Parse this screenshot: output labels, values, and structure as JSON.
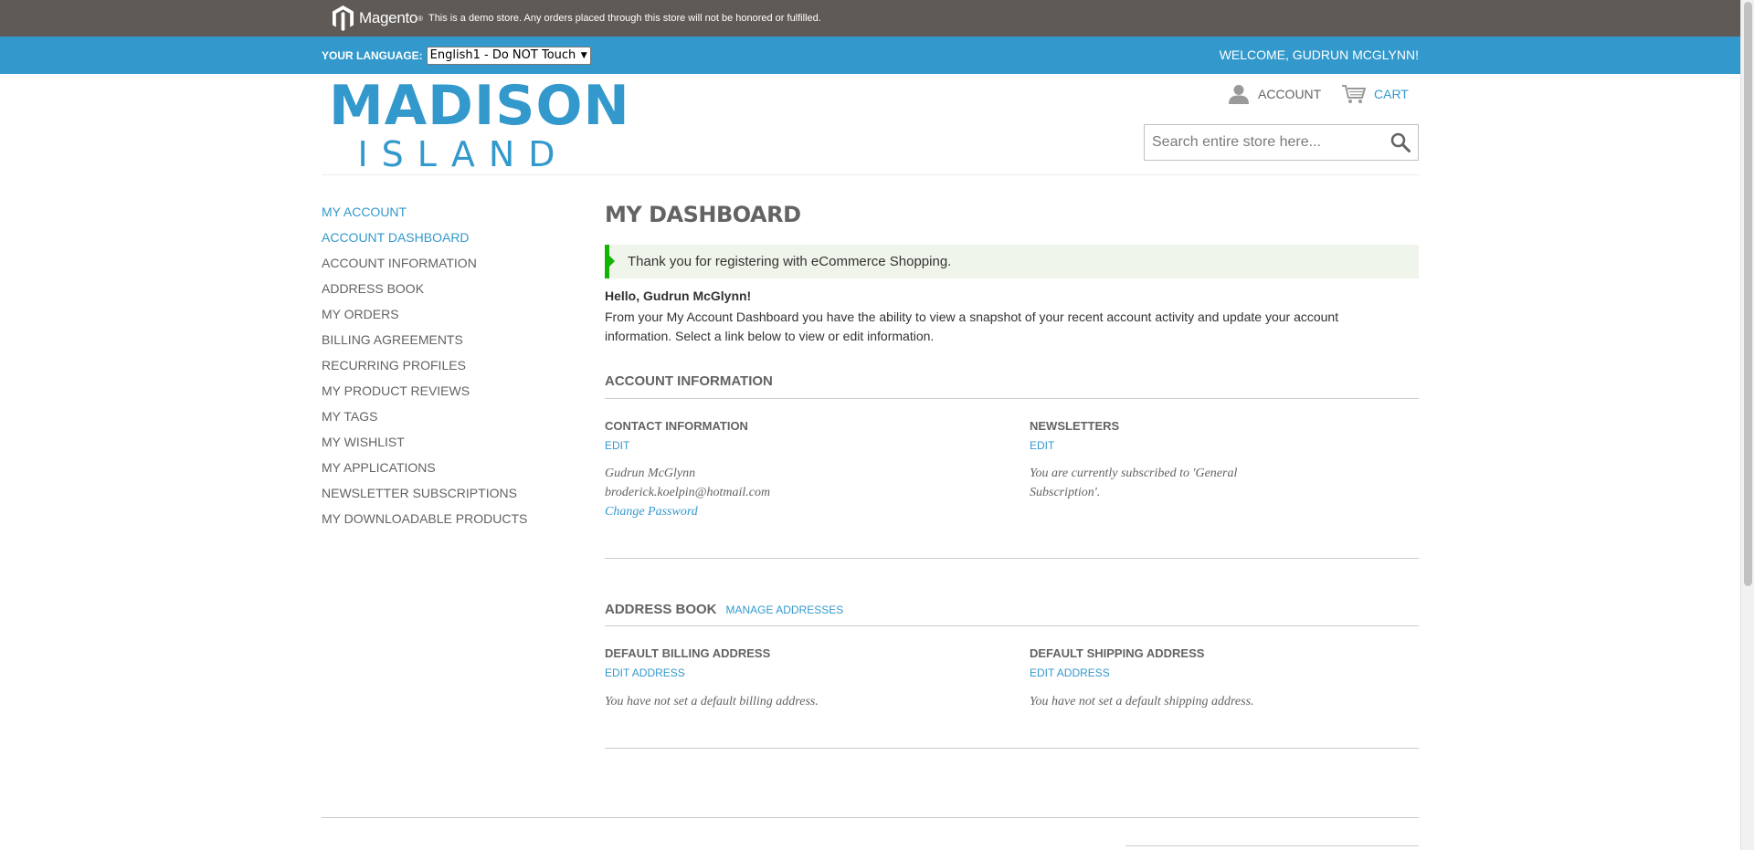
{
  "demo_notice": {
    "brand": "Magento",
    "text": "This is a demo store. Any orders placed through this store will not be honored or fulfilled."
  },
  "language_bar": {
    "label": "Your Language:",
    "selected": "English1 - Do NOT Touch",
    "welcome": "WELCOME, GUDRUN MCGLYNN!"
  },
  "logo": {
    "line1": "MADISON",
    "line2": "ISLAND"
  },
  "header": {
    "account": "Account",
    "cart": "Cart",
    "search_placeholder": "Search entire store here..."
  },
  "sidebar": {
    "title": "My Account",
    "items": [
      {
        "label": "Account Dashboard",
        "current": true
      },
      {
        "label": "Account Information"
      },
      {
        "label": "Address Book"
      },
      {
        "label": "My Orders"
      },
      {
        "label": "Billing Agreements"
      },
      {
        "label": "Recurring Profiles"
      },
      {
        "label": "My Product Reviews"
      },
      {
        "label": "My Tags"
      },
      {
        "label": "My Wishlist"
      },
      {
        "label": "My Applications"
      },
      {
        "label": "Newsletter Subscriptions"
      },
      {
        "label": "My Downloadable Products"
      }
    ]
  },
  "main": {
    "title": "My Dashboard",
    "success_message": "Thank you for registering with eCommerce Shopping.",
    "hello": "Hello, Gudrun McGlynn!",
    "intro": "From your My Account Dashboard you have the ability to view a snapshot of your recent account activity and update your account information. Select a link below to view or edit information.",
    "account_info": {
      "title": "Account Information",
      "contact": {
        "title": "Contact Information",
        "edit": "Edit",
        "name": "Gudrun McGlynn",
        "email": "broderick.koelpin@hotmail.com",
        "change_password": "Change Password"
      },
      "newsletters": {
        "title": "Newsletters",
        "edit": "Edit",
        "text": "You are currently subscribed to 'General Subscription'."
      }
    },
    "address_book": {
      "title": "Address Book",
      "manage": "Manage Addresses",
      "billing": {
        "title": "Default Billing Address",
        "edit": "Edit Address",
        "text": "You have not set a default billing address."
      },
      "shipping": {
        "title": "Default Shipping Address",
        "edit": "Edit Address",
        "text": "You have not set a default shipping address."
      }
    }
  },
  "colors": {
    "accent": "#3399cc",
    "demo_bar": "#5f5a56",
    "success": "#11b400"
  }
}
